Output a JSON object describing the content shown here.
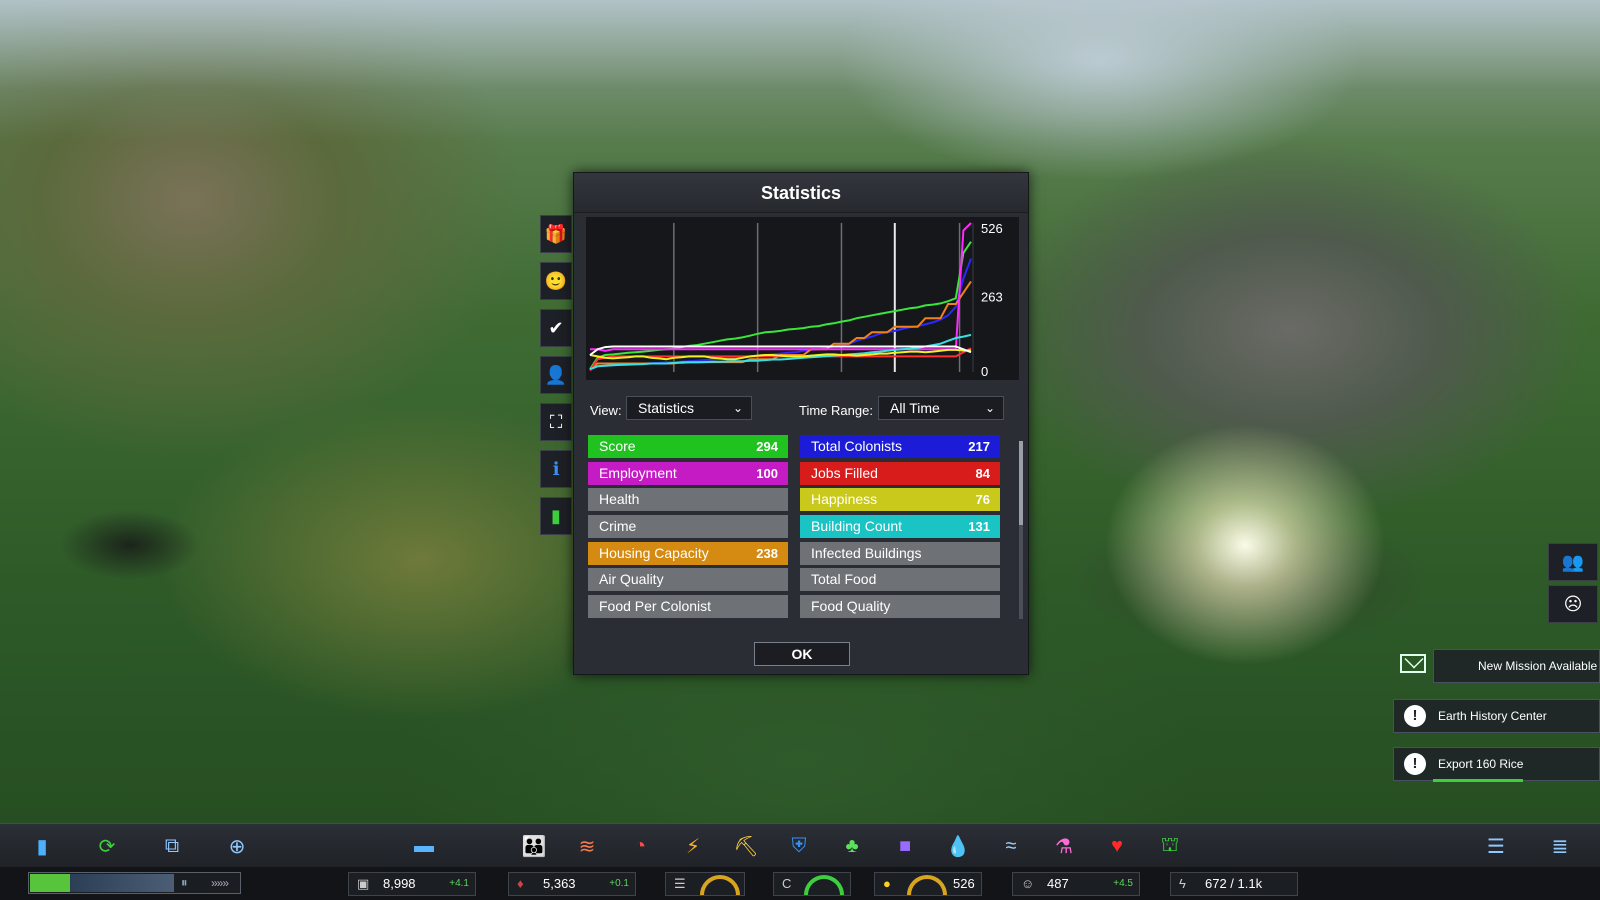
{
  "dialog": {
    "title": "Statistics",
    "view_label": "View:",
    "view_value": "Statistics",
    "time_range_label": "Time Range:",
    "time_range_value": "All Time",
    "ok_label": "OK"
  },
  "stats_left": [
    {
      "label": "Score",
      "value": "294",
      "color": "#1fc21f"
    },
    {
      "label": "Employment",
      "value": "100",
      "color": "#c51bc5"
    },
    {
      "label": "Health",
      "value": "",
      "color": ""
    },
    {
      "label": "Crime",
      "value": "",
      "color": ""
    },
    {
      "label": "Housing Capacity",
      "value": "238",
      "color": "#d58a12"
    },
    {
      "label": "Air Quality",
      "value": "",
      "color": ""
    },
    {
      "label": "Food Per Colonist",
      "value": "",
      "color": ""
    }
  ],
  "stats_right": [
    {
      "label": "Total Colonists",
      "value": "217",
      "color": "#1b1bd8"
    },
    {
      "label": "Jobs Filled",
      "value": "84",
      "color": "#d81b1b"
    },
    {
      "label": "Happiness",
      "value": "76",
      "color": "#c9c91b"
    },
    {
      "label": "Building Count",
      "value": "131",
      "color": "#1bc4c4"
    },
    {
      "label": "Infected Buildings",
      "value": "",
      "color": ""
    },
    {
      "label": "Total Food",
      "value": "",
      "color": ""
    },
    {
      "label": "Food Quality",
      "value": "",
      "color": ""
    }
  ],
  "chart_data": {
    "type": "line",
    "y_ticks": [
      "526",
      "263",
      "0"
    ],
    "ylim": [
      0,
      526
    ],
    "x": [
      0,
      2,
      4,
      6,
      8,
      10,
      12,
      14,
      16,
      18,
      20,
      22,
      24,
      26,
      28,
      30,
      32,
      34,
      36,
      38,
      40,
      42,
      44,
      46,
      48,
      50,
      52,
      54,
      56,
      58,
      60,
      62,
      64,
      66,
      68,
      70,
      72,
      74,
      76,
      78,
      80,
      82,
      84,
      86,
      88,
      90,
      92,
      94,
      96,
      98,
      100
    ],
    "series": [
      {
        "name": "Score",
        "color": "#39e639",
        "values": [
          10,
          50,
          60,
          62,
          65,
          68,
          70,
          72,
          75,
          78,
          80,
          82,
          88,
          92,
          95,
          100,
          105,
          110,
          115,
          118,
          122,
          128,
          135,
          140,
          142,
          145,
          150,
          152,
          155,
          160,
          162,
          168,
          172,
          178,
          182,
          190,
          195,
          200,
          205,
          210,
          215,
          220,
          225,
          228,
          235,
          238,
          242,
          250,
          260,
          420,
          460
        ]
      },
      {
        "name": "Total Colonists",
        "color": "#2a2aff",
        "values": [
          8,
          20,
          22,
          24,
          25,
          26,
          28,
          30,
          31,
          32,
          34,
          35,
          36,
          38,
          40,
          42,
          44,
          46,
          48,
          50,
          52,
          55,
          58,
          60,
          62,
          65,
          68,
          70,
          75,
          78,
          80,
          85,
          90,
          95,
          100,
          110,
          118,
          125,
          135,
          140,
          145,
          152,
          158,
          162,
          168,
          175,
          185,
          200,
          230,
          330,
          400
        ]
      },
      {
        "name": "Housing Capacity",
        "color": "#f0821e",
        "values": [
          10,
          30,
          30,
          30,
          30,
          30,
          30,
          30,
          30,
          30,
          30,
          30,
          35,
          35,
          35,
          35,
          35,
          35,
          35,
          35,
          35,
          45,
          45,
          45,
          45,
          60,
          60,
          60,
          60,
          80,
          80,
          80,
          100,
          100,
          100,
          120,
          120,
          140,
          140,
          140,
          160,
          160,
          160,
          160,
          190,
          190,
          190,
          240,
          240,
          280,
          320
        ]
      },
      {
        "name": "Employment",
        "color": "#ff2aff",
        "values": [
          80,
          80,
          75,
          80,
          80,
          80,
          80,
          80,
          80,
          80,
          80,
          80,
          80,
          80,
          80,
          80,
          80,
          80,
          80,
          80,
          80,
          80,
          80,
          80,
          80,
          80,
          80,
          80,
          80,
          80,
          80,
          80,
          80,
          80,
          80,
          80,
          80,
          80,
          80,
          80,
          80,
          80,
          80,
          80,
          80,
          80,
          80,
          80,
          80,
          500,
          526
        ]
      },
      {
        "name": "Jobs Filled",
        "color": "#ff3030",
        "values": [
          5,
          45,
          50,
          55,
          55,
          55,
          55,
          55,
          55,
          55,
          55,
          55,
          55,
          55,
          55,
          55,
          55,
          55,
          55,
          55,
          55,
          55,
          55,
          55,
          55,
          55,
          55,
          55,
          55,
          55,
          55,
          55,
          55,
          55,
          55,
          55,
          55,
          55,
          55,
          55,
          55,
          55,
          55,
          55,
          55,
          55,
          55,
          55,
          55,
          70,
          84
        ]
      },
      {
        "name": "Building Count",
        "color": "#3ae0e0",
        "values": [
          10,
          20,
          22,
          24,
          25,
          26,
          27,
          28,
          30,
          30,
          30,
          32,
          33,
          34,
          34,
          35,
          36,
          36,
          37,
          38,
          38,
          40,
          40,
          42,
          44,
          44,
          46,
          48,
          50,
          52,
          54,
          56,
          58,
          60,
          62,
          64,
          66,
          70,
          72,
          75,
          78,
          80,
          82,
          85,
          90,
          95,
          100,
          110,
          120,
          125,
          131
        ]
      },
      {
        "name": "Happiness",
        "color": "#f0f020",
        "values": [
          60,
          55,
          50,
          48,
          50,
          52,
          55,
          55,
          50,
          48,
          45,
          50,
          52,
          55,
          55,
          55,
          50,
          48,
          45,
          45,
          50,
          55,
          58,
          60,
          60,
          58,
          55,
          55,
          55,
          58,
          60,
          62,
          62,
          60,
          60,
          58,
          60,
          62,
          65,
          65,
          68,
          70,
          72,
          72,
          70,
          72,
          75,
          78,
          78,
          76,
          76
        ]
      },
      {
        "name": "",
        "color": "#ffffff",
        "values": [
          60,
          80,
          88,
          90,
          90,
          90,
          90,
          90,
          90,
          90,
          90,
          90,
          90,
          90,
          90,
          90,
          90,
          90,
          90,
          90,
          90,
          90,
          90,
          90,
          90,
          90,
          90,
          90,
          90,
          90,
          90,
          90,
          90,
          90,
          90,
          90,
          90,
          90,
          90,
          90,
          90,
          90,
          90,
          90,
          90,
          90,
          90,
          90,
          90,
          80,
          70
        ]
      }
    ]
  },
  "notifications": [
    {
      "label": "New Mission Available"
    },
    {
      "label": "Earth History Center"
    },
    {
      "label": "Export 160 Rice"
    }
  ],
  "resources": {
    "money": "8,998",
    "money_delta": "+4.1",
    "water": "5,363",
    "water_delta": "+0.1",
    "score": "526",
    "colonists": "487",
    "colonists_delta": "+4.5",
    "energy": "672 / 1.1k"
  }
}
